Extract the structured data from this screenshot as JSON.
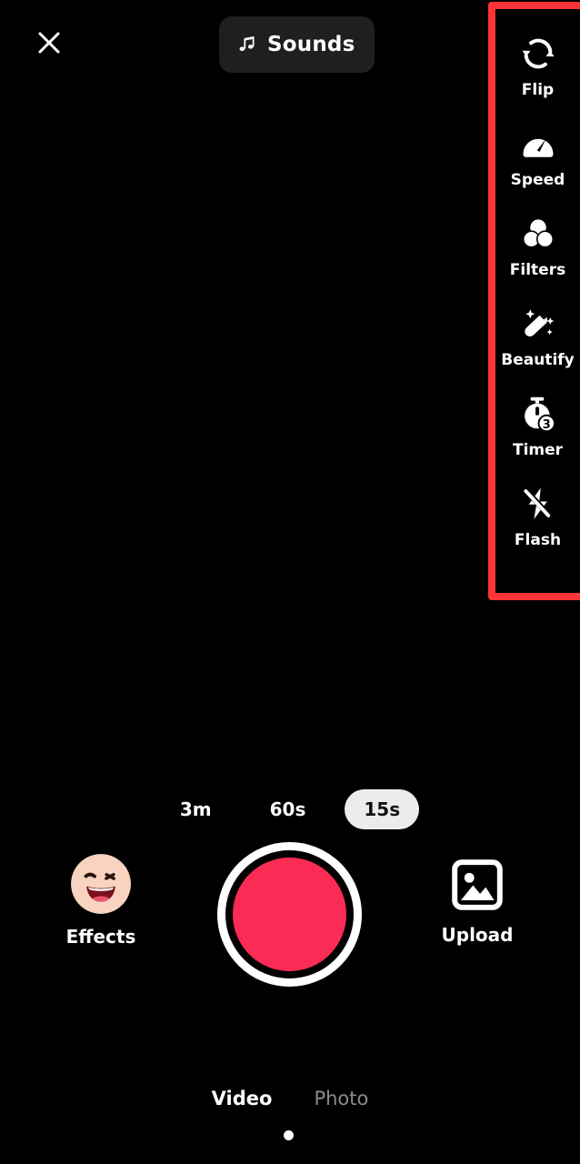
{
  "app": {
    "title": "Camera Recorder",
    "background_color": "#000000",
    "accent_color": "#FA2B55",
    "highlight_color": "#FC3437"
  },
  "top_bar": {
    "close_icon": "close-icon",
    "sounds": {
      "label": "Sounds",
      "icon": "music-note-icon"
    }
  },
  "tool_sidebar": {
    "highlighted": true,
    "items": [
      {
        "label": "Flip",
        "icon": "camera-flip-icon"
      },
      {
        "label": "Speed",
        "icon": "speedometer-icon"
      },
      {
        "label": "Filters",
        "icon": "filters-circles-icon"
      },
      {
        "label": "Beautify",
        "icon": "magic-wand-icon"
      },
      {
        "label": "Timer",
        "icon": "stopwatch-icon",
        "badge": "3"
      },
      {
        "label": "Flash",
        "icon": "flash-off-icon"
      }
    ]
  },
  "duration_selector": {
    "options": [
      {
        "label": "3m",
        "selected": false
      },
      {
        "label": "60s",
        "selected": false
      },
      {
        "label": "15s",
        "selected": true
      }
    ],
    "selected_value": "15s"
  },
  "capture_controls": {
    "effects": {
      "label": "Effects",
      "icon": "winking-face-icon"
    },
    "record": {
      "label": "",
      "icon": "record-button-icon",
      "color": "#FA2B55"
    },
    "upload": {
      "label": "Upload",
      "icon": "image-gallery-icon"
    }
  },
  "mode_tabs": {
    "items": [
      {
        "label": "Video",
        "active": true
      },
      {
        "label": "Photo",
        "active": false
      }
    ],
    "selected": "Video"
  }
}
